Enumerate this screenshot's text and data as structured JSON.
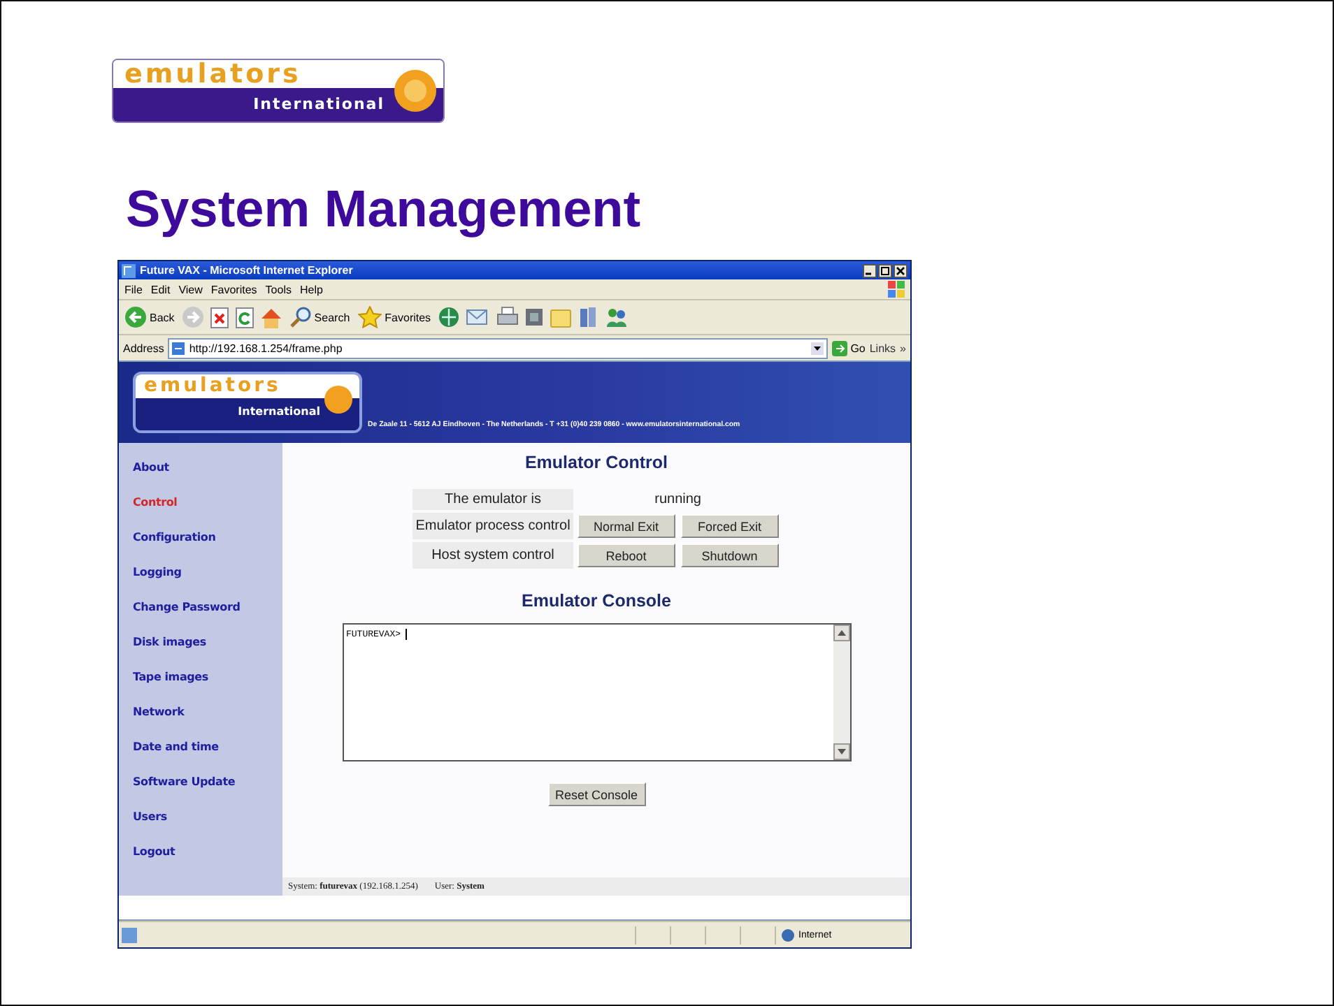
{
  "slide": {
    "logo": {
      "word": "emulators",
      "subword": "International"
    },
    "title": "System Management"
  },
  "browser": {
    "title": "Future VAX - Microsoft Internet Explorer",
    "menu": [
      "File",
      "Edit",
      "View",
      "Favorites",
      "Tools",
      "Help"
    ],
    "toolbar": [
      {
        "kind": "back",
        "label": "Back"
      },
      {
        "kind": "forward"
      },
      {
        "kind": "stop"
      },
      {
        "kind": "refresh"
      },
      {
        "kind": "home"
      },
      {
        "kind": "search",
        "label": "Search"
      },
      {
        "kind": "favorites",
        "label": "Favorites"
      },
      {
        "kind": "media"
      },
      {
        "kind": "mail"
      },
      {
        "kind": "print"
      },
      {
        "kind": "edit"
      },
      {
        "kind": "folder"
      },
      {
        "kind": "research"
      },
      {
        "kind": "messenger"
      }
    ],
    "address": {
      "label": "Address",
      "url": "http://192.168.1.254/frame.php",
      "go": "Go",
      "links": "Links",
      "more": "»"
    },
    "status": {
      "zone": "Internet"
    }
  },
  "page": {
    "banner": {
      "word": "emulators",
      "subword": "International",
      "contact": "De Zaale 11 - 5612 AJ Eindhoven - The Netherlands - T +31 (0)40 239 0860 - www.emulatorsinternational.com"
    },
    "sidebar": {
      "items": [
        {
          "label": "About",
          "selected": false
        },
        {
          "label": "Control",
          "selected": true
        },
        {
          "label": "Configuration",
          "selected": false
        },
        {
          "label": "Logging",
          "selected": false
        },
        {
          "label": "Change Password",
          "selected": false
        },
        {
          "label": "Disk images",
          "selected": false
        },
        {
          "label": "Tape images",
          "selected": false
        },
        {
          "label": "Network",
          "selected": false
        },
        {
          "label": "Date and time",
          "selected": false
        },
        {
          "label": "Software Update",
          "selected": false
        },
        {
          "label": "Users",
          "selected": false
        },
        {
          "label": "Logout",
          "selected": false
        }
      ]
    },
    "control": {
      "heading": "Emulator Control",
      "rows": [
        {
          "kind": "status",
          "label": "The emulator is",
          "value": "running"
        },
        {
          "kind": "buttons",
          "label": "Emulator process control",
          "buttons": [
            "Normal Exit",
            "Forced Exit"
          ]
        },
        {
          "kind": "buttons",
          "label": "Host system control",
          "buttons": [
            "Reboot",
            "Shutdown"
          ]
        }
      ]
    },
    "console": {
      "heading": "Emulator Console",
      "text": "FUTUREVAX>",
      "reset": "Reset Console"
    },
    "footer": {
      "system": "System: **futurevax** (192.168.1.254)",
      "user": "User: **System**"
    }
  }
}
